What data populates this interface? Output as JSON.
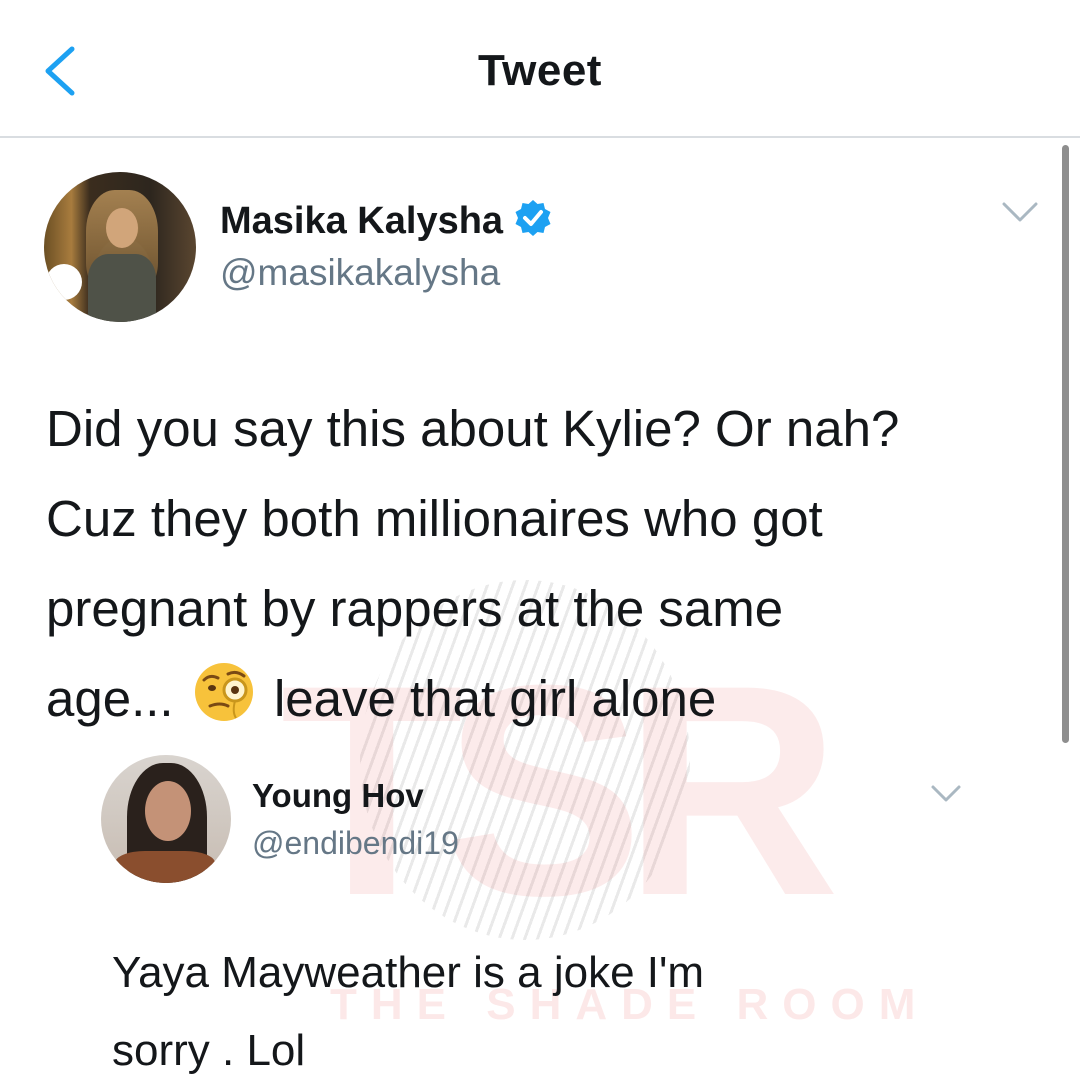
{
  "header": {
    "title": "Tweet",
    "back_icon": "chevron-left-icon"
  },
  "tweet": {
    "author_name": "Masika Kalysha",
    "author_handle": "@masikakalysha",
    "verified": true,
    "text_lines": [
      "Did you say this about Kylie? Or nah?",
      "Cuz they both millionaires who got",
      "pregnant by rappers at the same"
    ],
    "text_last_before_emoji": "age...",
    "emoji": "face-with-monocle-emoji",
    "text_last_after_emoji": "leave that girl alone"
  },
  "quoted": {
    "author_name": "Young Hov",
    "author_handle": "@endibendi19",
    "text_lines": [
      "Yaya Mayweather is a joke I'm",
      "sorry . Lol"
    ]
  },
  "watermark": {
    "letters": "TSR",
    "subtitle": "THE SHADE ROOM"
  },
  "colors": {
    "accent": "#1da1f2",
    "text": "#14171a",
    "secondary": "#657786",
    "divider": "#d9dde1"
  }
}
